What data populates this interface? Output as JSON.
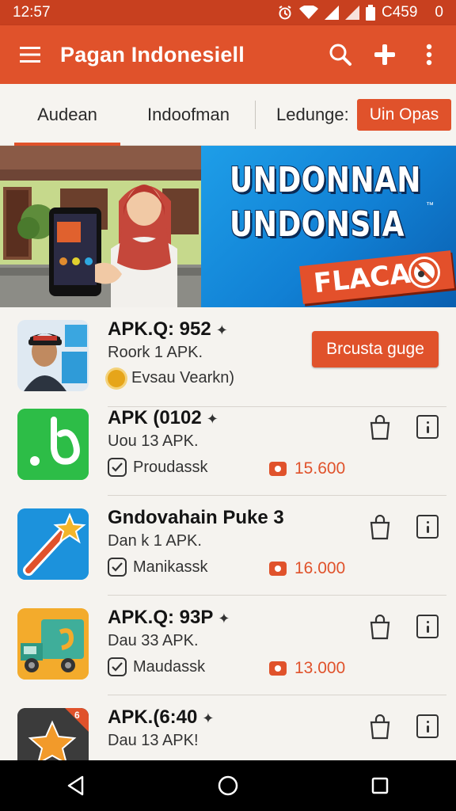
{
  "status_bar": {
    "time": "12:57",
    "battery_text": "C459",
    "extra_text": "0",
    "icons": [
      "alarm-icon",
      "wifi-icon",
      "signal-icon",
      "signal-icon",
      "battery-icon"
    ]
  },
  "app_bar": {
    "title": "Pagan Indonesiell",
    "icons": [
      "menu-icon",
      "search-icon",
      "add-icon",
      "more-vert-icon"
    ]
  },
  "tabs": [
    {
      "label": "Audean",
      "active": true
    },
    {
      "label": "Indoofman",
      "active": false
    }
  ],
  "filter": {
    "label": "Ledunge:",
    "button": "Uin Opas"
  },
  "banner": {
    "line1": "UNDONNAN",
    "line2": "UNDONSIA",
    "tag": "FLACA",
    "tm": "™"
  },
  "apps": [
    {
      "name": "APK.Q: 952",
      "subtitle": "Roork 1 APK.",
      "meta": "Evsau Vearkn)",
      "meta_icon": "sun-icon",
      "cta": "Brcusta guge",
      "icon": "person-photo"
    },
    {
      "name": "APK (0102",
      "subtitle": "Uou 13 APK.",
      "meta": "Proudassk",
      "meta_icon": "check-icon",
      "price": "15.600",
      "icon": "green-b-app-icon"
    },
    {
      "name": "Gndovahain Puke 3",
      "subtitle": "Dan k 1 APK.",
      "meta": "Manikassk",
      "meta_icon": "check-icon",
      "price": "16.000",
      "icon": "wand-app-icon"
    },
    {
      "name": "APK.Q: 93P",
      "subtitle": "Dau 33 APK.",
      "meta": "Maudassk",
      "meta_icon": "check-icon",
      "price": "13.000",
      "icon": "truck-app-icon"
    },
    {
      "name": "APK.(6:40",
      "subtitle": "Dau 13 APK!",
      "icon": "star-app-icon",
      "badge": "6"
    }
  ],
  "colors": {
    "status_bar": "#c8401f",
    "app_bar": "#e0522b",
    "accent": "#e0522b",
    "background": "#f5f3ef"
  },
  "nav_bar": {
    "icons": [
      "back-icon",
      "home-icon",
      "recents-icon"
    ]
  }
}
